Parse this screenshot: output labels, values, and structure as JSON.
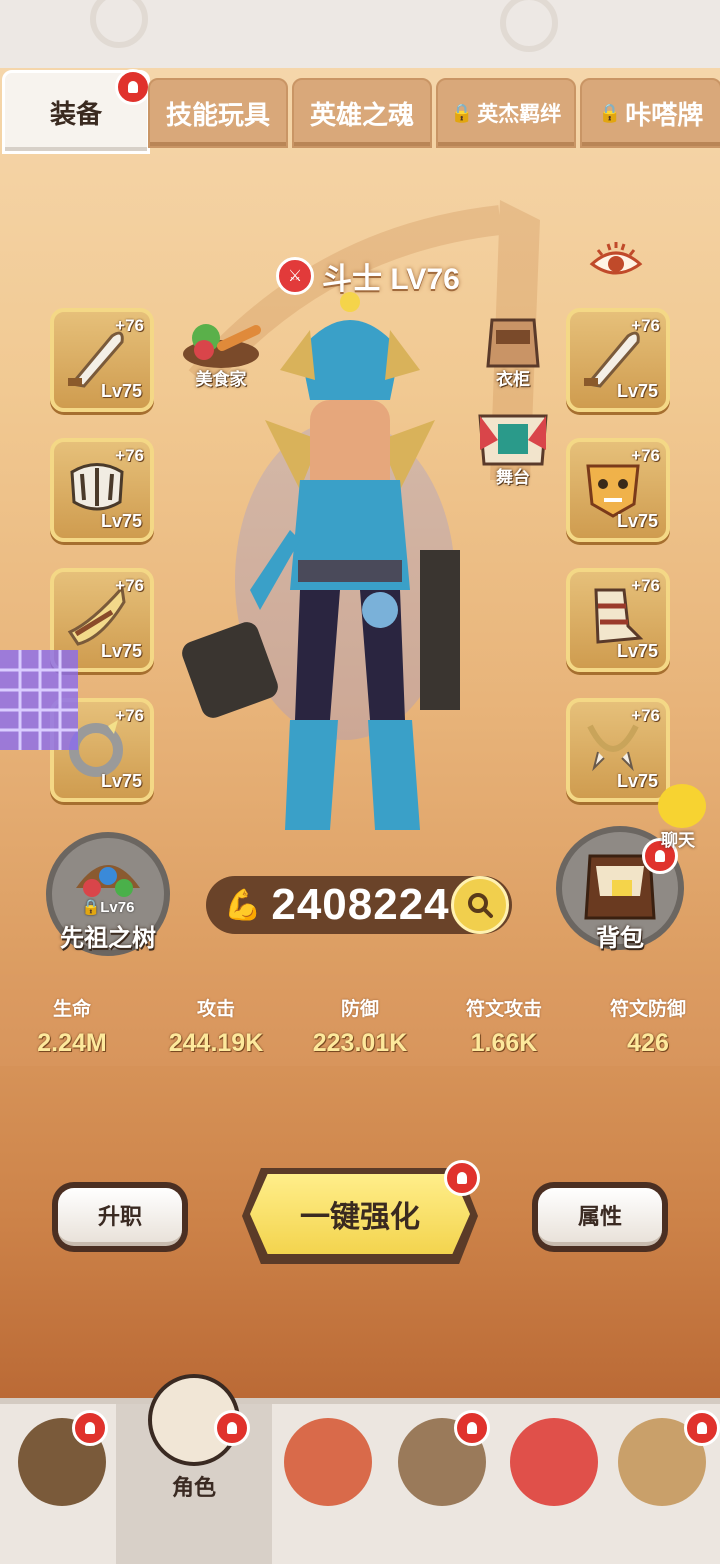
{
  "tabs": [
    {
      "label": "装备",
      "active": true,
      "locked": false,
      "badge": true
    },
    {
      "label": "技能玩具",
      "active": false,
      "locked": false,
      "badge": false
    },
    {
      "label": "英雄之魂",
      "active": false,
      "locked": false,
      "badge": false
    },
    {
      "label": "英杰羁绊",
      "active": false,
      "locked": true,
      "badge": false
    },
    {
      "label": "咔嗒牌",
      "active": false,
      "locked": true,
      "badge": false
    }
  ],
  "hero": {
    "name": "斗士 LV76",
    "class_icon": "crossed-swords-icon"
  },
  "left_slots": [
    {
      "plus": "+76",
      "level": "Lv75",
      "icon": "curved-blade-icon"
    },
    {
      "plus": "+76",
      "level": "Lv75",
      "icon": "horn-bracer-icon"
    },
    {
      "plus": "+76",
      "level": "Lv75",
      "icon": "horn-arm-icon"
    },
    {
      "plus": "+76",
      "level": "Lv75",
      "icon": "tooth-ring-icon"
    }
  ],
  "right_slots": [
    {
      "plus": "+76",
      "level": "Lv75",
      "icon": "curved-blade-icon"
    },
    {
      "plus": "+76",
      "level": "Lv75",
      "icon": "beast-mask-icon"
    },
    {
      "plus": "+76",
      "level": "Lv75",
      "icon": "wrap-boots-icon"
    },
    {
      "plus": "+76",
      "level": "Lv75",
      "icon": "fang-necklace-icon"
    }
  ],
  "costumes": {
    "gourmet": "美食家",
    "wardrobe": "衣柜",
    "stage": "舞台"
  },
  "ancestor_tree": {
    "label": "先祖之树",
    "level": "Lv76"
  },
  "power": {
    "value": "2408224"
  },
  "backpack": {
    "label": "背包"
  },
  "chat": {
    "label": "聊天"
  },
  "stats": [
    {
      "key": "生命",
      "value": "2.24M"
    },
    {
      "key": "攻击",
      "value": "244.19K"
    },
    {
      "key": "防御",
      "value": "223.01K"
    },
    {
      "key": "符文攻击",
      "value": "1.66K"
    },
    {
      "key": "符文防御",
      "value": "426"
    }
  ],
  "actions": {
    "promote": "升职",
    "enhance_all": "一键强化",
    "attributes": "属性"
  },
  "nav": [
    {
      "label": "",
      "icon": "raccoon-house-icon",
      "badge": true
    },
    {
      "label": "角色",
      "icon": "skull-helmet-icon",
      "badge": true,
      "active": true
    },
    {
      "label": "",
      "icon": "tiki-totem-icon",
      "badge": false
    },
    {
      "label": "",
      "icon": "elder-warrior-icon",
      "badge": true
    },
    {
      "label": "",
      "icon": "red-dragon-icon",
      "badge": false
    },
    {
      "label": "",
      "icon": "tribal-camp-icon",
      "badge": true
    }
  ],
  "colors": {
    "accent_gold": "#f3d44e",
    "badge_red": "#e0322c",
    "stat_value": "#fde99c"
  }
}
